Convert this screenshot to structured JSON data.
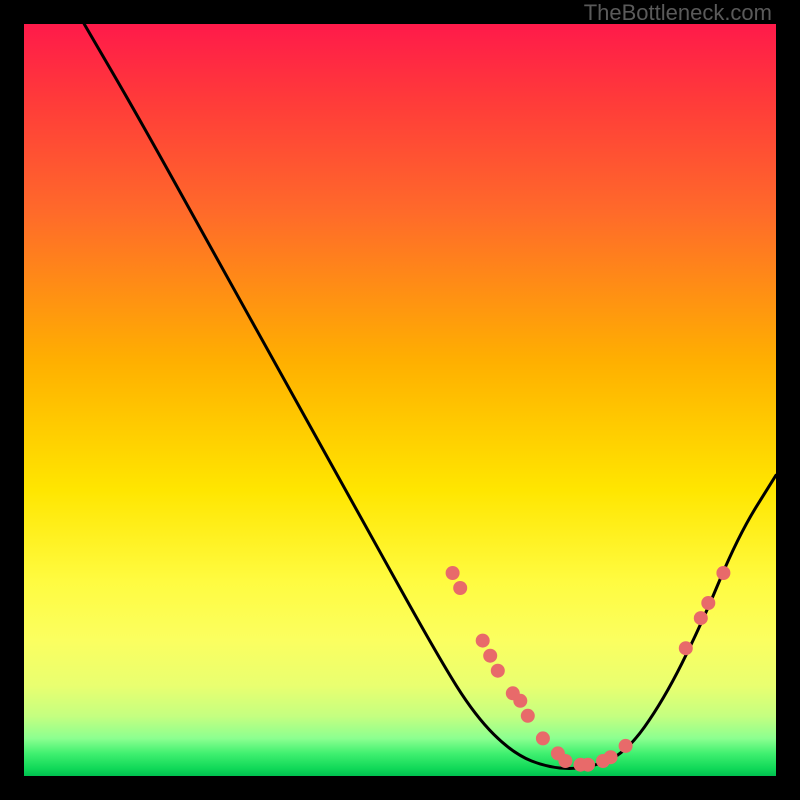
{
  "watermark": "TheBottleneck.com",
  "chart_data": {
    "type": "line",
    "title": "",
    "xlabel": "",
    "ylabel": "",
    "xlim": [
      0,
      100
    ],
    "ylim": [
      0,
      100
    ],
    "curve": [
      {
        "x": 8,
        "y": 100
      },
      {
        "x": 15,
        "y": 88
      },
      {
        "x": 25,
        "y": 70
      },
      {
        "x": 35,
        "y": 52
      },
      {
        "x": 45,
        "y": 34
      },
      {
        "x": 55,
        "y": 16
      },
      {
        "x": 60,
        "y": 8
      },
      {
        "x": 65,
        "y": 3
      },
      {
        "x": 70,
        "y": 1
      },
      {
        "x": 75,
        "y": 1
      },
      {
        "x": 80,
        "y": 3
      },
      {
        "x": 85,
        "y": 10
      },
      {
        "x": 90,
        "y": 20
      },
      {
        "x": 95,
        "y": 32
      },
      {
        "x": 100,
        "y": 40
      }
    ],
    "markers": [
      {
        "x": 57,
        "y": 27
      },
      {
        "x": 58,
        "y": 25
      },
      {
        "x": 61,
        "y": 18
      },
      {
        "x": 62,
        "y": 16
      },
      {
        "x": 63,
        "y": 14
      },
      {
        "x": 65,
        "y": 11
      },
      {
        "x": 66,
        "y": 10
      },
      {
        "x": 67,
        "y": 8
      },
      {
        "x": 69,
        "y": 5
      },
      {
        "x": 71,
        "y": 3
      },
      {
        "x": 72,
        "y": 2
      },
      {
        "x": 74,
        "y": 1.5
      },
      {
        "x": 75,
        "y": 1.5
      },
      {
        "x": 77,
        "y": 2
      },
      {
        "x": 78,
        "y": 2.5
      },
      {
        "x": 80,
        "y": 4
      },
      {
        "x": 88,
        "y": 17
      },
      {
        "x": 90,
        "y": 21
      },
      {
        "x": 91,
        "y": 23
      },
      {
        "x": 93,
        "y": 27
      }
    ],
    "marker_color": "#e86a6a",
    "curve_color": "#000000"
  }
}
